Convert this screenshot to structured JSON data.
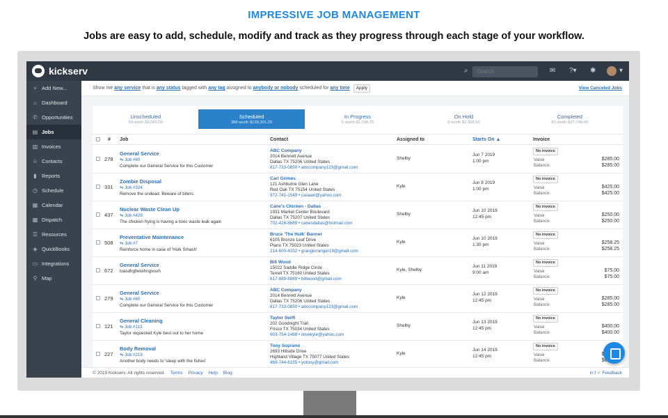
{
  "headline": "IMPRESSIVE JOB MANAGEMENT",
  "subline": "Jobs are easy to add, schedule, modify and track as they progress through each stage of your workflow.",
  "app": {
    "name": "kickserv",
    "search_placeholder": "Search"
  },
  "sidebar": {
    "items": [
      {
        "label": "Add New...",
        "icon": "+"
      },
      {
        "label": "Dashboard",
        "icon": "⌂"
      },
      {
        "label": "Opportunities",
        "icon": "✆"
      },
      {
        "label": "Jobs",
        "icon": "▤"
      },
      {
        "label": "Invoices",
        "icon": "▥"
      },
      {
        "label": "Contacts",
        "icon": "☺"
      },
      {
        "label": "Reports",
        "icon": "▮"
      },
      {
        "label": "Schedule",
        "icon": "◷"
      },
      {
        "label": "Calendar",
        "icon": "▦"
      },
      {
        "label": "Dispatch",
        "icon": "▩"
      },
      {
        "label": "Resources",
        "icon": "☰"
      },
      {
        "label": "QuickBooks",
        "icon": "◈"
      },
      {
        "label": "Integrations",
        "icon": "▭"
      },
      {
        "label": "Map",
        "icon": "⚲"
      }
    ]
  },
  "filter": {
    "t1": "Show me",
    "any_service": "any service",
    "t2": "that is",
    "any_status": "any status",
    "t3": "tagged with",
    "any_tag": "any tag",
    "t4": "assigned to",
    "anybody": "anybody or nobody",
    "t5": "scheduled for",
    "any_time": "any time",
    "apply": "Apply",
    "view_canceled": "View Canceled Jobs"
  },
  "tabs": [
    {
      "label": "Unscheduled",
      "sub": "50 worth $9,065.00"
    },
    {
      "label": "Scheduled",
      "sub": "388 worth $139,301.25"
    },
    {
      "label": "In Progress",
      "sub": "6 worth $2,198.25"
    },
    {
      "label": "On Hold",
      "sub": "8 worth $2,368.50"
    },
    {
      "label": "Completed",
      "sub": "81 worth $27,748.00"
    }
  ],
  "columns": {
    "hash": "#",
    "job": "Job",
    "contact": "Contact",
    "assigned": "Assigned to",
    "starts": "Starts On ▲",
    "invoice": "Invoice"
  },
  "rows": [
    {
      "num": "278",
      "title": "General Service",
      "job": "⇆ Job #60",
      "desc": "Complete our General Service for this Customer",
      "cname": "ABC Company",
      "c1": "2014 Bennett Avenue",
      "c2": "Dallas TX 75206 United States",
      "c3": "817-733-0850 • abccompany123@gmail.com",
      "assigned": "Shelby",
      "date": "Jun 7 2019",
      "time": "1:00 pm",
      "badge": "No invoice",
      "l1": "Value",
      "l2": "Balance",
      "v1": "$285.00",
      "v2": "$285.00"
    },
    {
      "num": "331",
      "title": "Zombie Disposal",
      "job": "⇆ Job #324",
      "desc": "Remove the undead. Beware of biters.",
      "cname": "Carl Grimes",
      "c1": "121 Ashburne Glen Lane",
      "c2": "Red Oak TX 75154 United States",
      "c3": "972-741-1549 • casaari@yahoo.com",
      "assigned": "Kyle",
      "date": "Jun 8 2019",
      "time": "1:00 pm",
      "badge": "No invoice",
      "l1": "Value",
      "l2": "Balance",
      "v1": "$425.00",
      "v2": "$425.00"
    },
    {
      "num": "437",
      "title": "Nuclear Waste Clean Up",
      "job": "⇆ Job #429",
      "desc": "The chicken frying is having a toxic waste leak again",
      "cname": "Cane's Chicken - Dallas",
      "c1": "1931 Market Center Boulevard",
      "c2": "Dallas TX 75207 United States",
      "c3": "702-426-8689 • canesdallas@hotmail.com",
      "assigned": "Shelby",
      "date": "Jun 10 2019",
      "time": "12:45 pm",
      "badge": "No invoice",
      "l1": "Value",
      "l2": "Balance",
      "v1": "$250.00",
      "v2": "$250.00"
    },
    {
      "num": "508",
      "title": "Preventative Maintenance",
      "job": "⇆ Job #7",
      "desc": "Reinforce home in case of 'Hulk Smash'",
      "cname": "Bruce 'The Hulk' Banner",
      "c1": "6105 Bronze Leaf Drive",
      "c2": "Plano TX 75023 United States",
      "c3": "214-600-4332 • grangerranger19@gmail.com",
      "assigned": "Kyle",
      "date": "Jun 10 2019",
      "time": "1:30 pm",
      "badge": "No invoice",
      "l1": "Value",
      "l2": "Balance",
      "v1": "$258.25",
      "v2": "$258.25"
    },
    {
      "num": "672",
      "title": "General Service",
      "job": "",
      "desc": "loasdhgfwloihngvouh",
      "cname": "Bill Wood",
      "c1": "15022 Saddle Ridge Circle",
      "c2": "Terrell TX 75160 United States",
      "c3": "817-889-8889 • billwood@gmail.com",
      "assigned": "Kyle, Shelby",
      "date": "Jun 11 2019",
      "time": "9:00 am",
      "badge": "No invoice",
      "l1": "Value",
      "l2": "Balance",
      "v1": "$75.00",
      "v2": "$75.00"
    },
    {
      "num": "279",
      "title": "General Service",
      "job": "⇆ Job #60",
      "desc": "Complete our General Service for this Customer",
      "cname": "ABC Company",
      "c1": "2014 Bennett Avenue",
      "c2": "Dallas TX 75206 United States",
      "c3": "817-733-0850 • abccompany123@gmail.com",
      "assigned": "Kyle",
      "date": "Jun 12 2019",
      "time": "12:45 pm",
      "badge": "No invoice",
      "l1": "Value",
      "l2": "Balance",
      "v1": "$285.00",
      "v2": "$285.00"
    },
    {
      "num": "121",
      "title": "General Cleaning",
      "job": "⇆ Job #113",
      "desc": "Taylor requested Kyle best out to her home",
      "cname": "Taylor Swift",
      "c1": "202 Goodnight Trail",
      "c2": "Frisco TX 75034 United States",
      "c3": "903-754-1488 • ilovekyle@yahoo.com",
      "assigned": "Shelby",
      "date": "Jun 13 2019",
      "time": "12:45 pm",
      "badge": "No invoice",
      "l1": "Value",
      "l2": "Balance",
      "v1": "$400.00",
      "v2": "$400.00"
    },
    {
      "num": "227",
      "title": "Body Removal",
      "job": "⇆ Job #219",
      "desc": "Another body needs to 'sleep with the fishes'",
      "cname": "Tony Soprano",
      "c1": "2693 Hillside Drive",
      "c2": "Highland Village TX 75077 United States",
      "c3": "469-744-6155 • yotony@gmail.com",
      "assigned": "Kyle",
      "date": "Jun 14 2019",
      "time": "12:45 pm",
      "badge": "No invoice",
      "l1": "Value",
      "l2": "Balance",
      "v1": "$625.00",
      "v2": "$625.00"
    }
  ],
  "footer": {
    "copy": "© 2019 Kickserv. All rights reserved.",
    "terms": "Terms",
    "privacy": "Privacy",
    "help": "Help",
    "blog": "Blog",
    "feedback": "in  f  ✓   Feedback"
  },
  "colors": {
    "accent": "#1e88e5",
    "topbar": "#2f3944",
    "sidebar": "#39434e",
    "active_tab": "#2c82c9"
  }
}
